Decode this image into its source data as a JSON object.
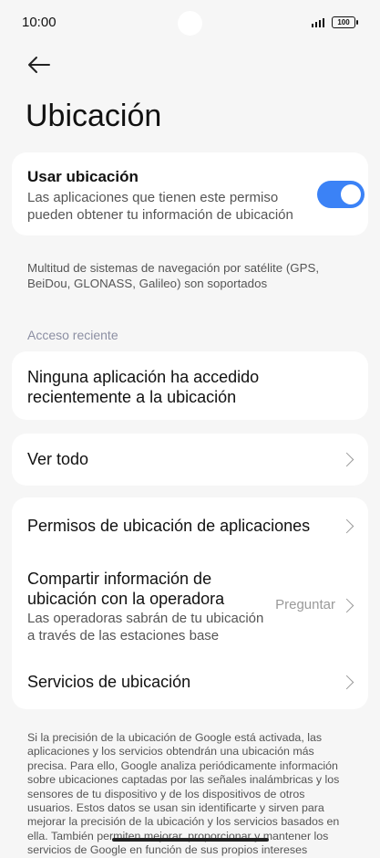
{
  "status_bar": {
    "time": "10:00",
    "battery": "100"
  },
  "header": {
    "title": "Ubicación",
    "back_icon": "arrow-left-icon"
  },
  "use_location": {
    "title": "Usar ubicación",
    "subtitle": "Las aplicaciones que tienen este permiso pueden obtener tu información de ubicación",
    "enabled": true,
    "toggle_color": "#3b82f6"
  },
  "gnss_note": "Multitud de sistemas de navegación por satélite (GPS, BeiDou, GLONASS, Galileo) son soportados",
  "recent_access": {
    "section_label": "Acceso reciente",
    "empty_message": "Ninguna aplicación ha accedido recientemente a la ubicación",
    "see_all": "Ver todo"
  },
  "settings": {
    "app_permissions": "Permisos de ubicación de aplicaciones",
    "carrier_share_title": "Compartir información de ubicación con la operadora",
    "carrier_share_sub": "Las operadoras sabrán de tu ubicación a través de las estaciones base",
    "carrier_share_value": "Preguntar",
    "location_services": "Servicios de ubicación"
  },
  "footer_text": "Si la precisión de la ubicación de Google está activada, las aplicaciones y los servicios obtendrán una ubicación más precisa. Para ello, Google analiza periódicamente información sobre ubicaciones captadas por las señales inalámbricas y los sensores de tu dispositivo y de los dispositivos de otros usuarios. Estos datos se usan sin identificarte y sirven para mejorar la precisión de la ubicación y los servicios basados en ella. También permiten mejorar, proporcionar y mantener los servicios de Google en función de sus propios intereses"
}
